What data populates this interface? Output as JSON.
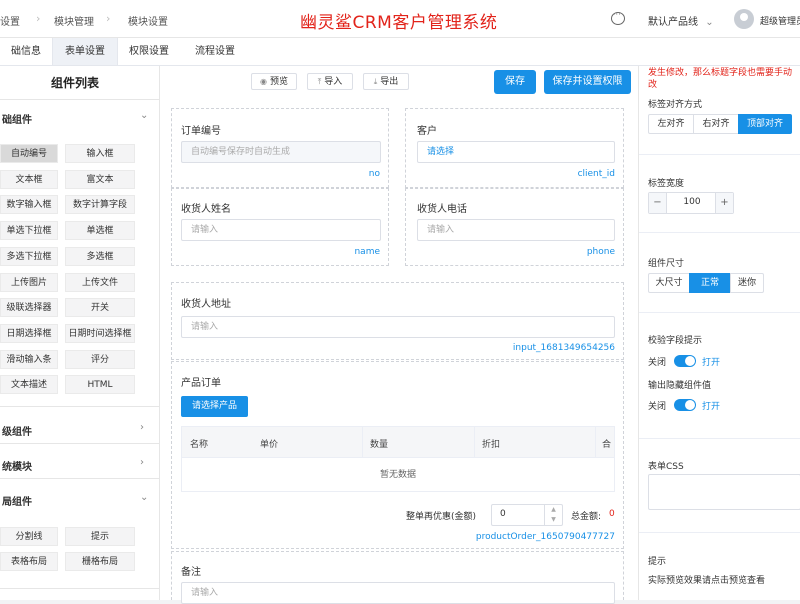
{
  "header": {
    "breadcrumb": [
      "设置",
      "模块管理",
      "模块设置"
    ],
    "title": "幽灵鲨CRM客户管理系统",
    "product_line": "默认产品线",
    "user_name": "超级管理员",
    "chat_icon": "chat-bubble-icon",
    "brand_color": "#e2231a"
  },
  "tabs": [
    "础信息",
    "表单设置",
    "权限设置",
    "流程设置"
  ],
  "active_tab": "表单设置",
  "left_panel": {
    "title": "组件列表",
    "groups": [
      {
        "label": "础组件",
        "expanded": true
      },
      {
        "label": "级组件",
        "expanded": false
      },
      {
        "label": "统模块",
        "expanded": false
      },
      {
        "label": "局组件",
        "expanded": true
      }
    ],
    "basic_components": [
      [
        "自动编号",
        "输入框"
      ],
      [
        "文本框",
        "富文本"
      ],
      [
        "数字输入框",
        "数字计算字段"
      ],
      [
        "单选下拉框",
        "单选框"
      ],
      [
        "多选下拉框",
        "多选框"
      ],
      [
        "上传图片",
        "上传文件"
      ],
      [
        "级联选择器",
        "开关"
      ],
      [
        "日期选择框",
        "日期时间选择框"
      ],
      [
        "滑动输入条",
        "评分"
      ],
      [
        "文本描述",
        "HTML"
      ]
    ],
    "layout_components": [
      [
        "分割线",
        "提示"
      ],
      [
        "表格布局",
        "栅格布局"
      ]
    ]
  },
  "toolbar": {
    "preview": "预览",
    "import": "导入",
    "export": "导出",
    "save": "保存",
    "save_permission": "保存并设置权限",
    "accent_color": "#1890e6"
  },
  "form": {
    "order_no": {
      "label": "订单编号",
      "placeholder": "自动编号保存时自动生成",
      "key": "no"
    },
    "client": {
      "label": "客户",
      "value": "请选择",
      "key": "client_id"
    },
    "receiver_name": {
      "label": "收货人姓名",
      "placeholder": "请输入",
      "key": "name"
    },
    "receiver_phone": {
      "label": "收货人电话",
      "placeholder": "请输入",
      "key": "phone"
    },
    "receiver_address": {
      "label": "收货人地址",
      "placeholder": "请输入",
      "key": "input_1681349654256"
    },
    "product_order": {
      "label": "产品订单",
      "select_button": "请选择产品",
      "columns": [
        "名称",
        "单价",
        "数量",
        "折扣",
        "合"
      ],
      "empty_text": "暂无数据",
      "discount_label": "整单再优惠(金额)",
      "discount_value": "0",
      "total_label": "总金额:",
      "total_value": "0",
      "key": "productOrder_1650790477727"
    },
    "remark": {
      "label": "备注",
      "placeholder": "请输入"
    }
  },
  "right_panel": {
    "warning_lines": [
      "发生修改，那么标题字段也需要手动",
      "改"
    ],
    "label_align": {
      "label": "标签对齐方式",
      "options": [
        "左对齐",
        "右对齐",
        "顶部对齐"
      ],
      "selected": "顶部对齐"
    },
    "label_width": {
      "label": "标签宽度",
      "value": "100",
      "minus": "−",
      "plus": "+"
    },
    "size": {
      "label": "组件尺寸",
      "options": [
        "大尺寸",
        "正常",
        "迷你"
      ],
      "selected": "正常"
    },
    "validate_hint": {
      "label": "校验字段提示",
      "off": "关闭",
      "on": "打开",
      "value": "on"
    },
    "output_hidden": {
      "label": "输出隐藏组件值",
      "off": "关闭",
      "on": "打开",
      "value": "on"
    },
    "form_css": {
      "label": "表单CSS"
    },
    "tip": {
      "label": "提示",
      "text": "实际预览效果请点击预览查看"
    }
  }
}
